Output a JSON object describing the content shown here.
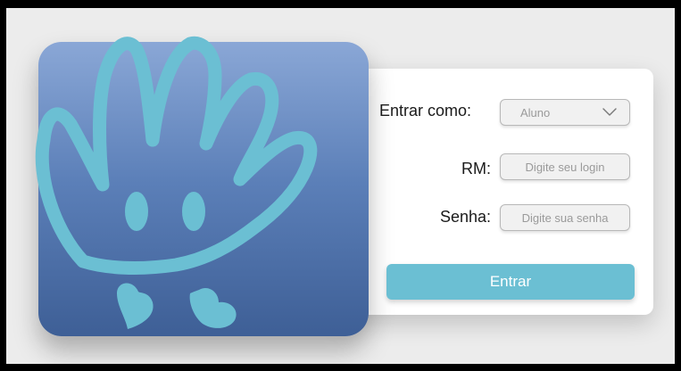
{
  "login": {
    "role_label": "Entrar como:",
    "role_selected": "Aluno",
    "rm_label": "RM:",
    "rm_placeholder": "Digite seu login",
    "password_label": "Senha:",
    "password_placeholder": "Digite sua senha",
    "submit_label": "Entrar"
  },
  "icons": {
    "logo": "hand-mascot-logo",
    "dropdown": "chevron-down-icon"
  },
  "colors": {
    "accent": "#6bbfd3",
    "logo_top": "#8aa7d6",
    "logo_bottom": "#3e5f96",
    "background": "#ececec",
    "card": "#ffffff"
  }
}
